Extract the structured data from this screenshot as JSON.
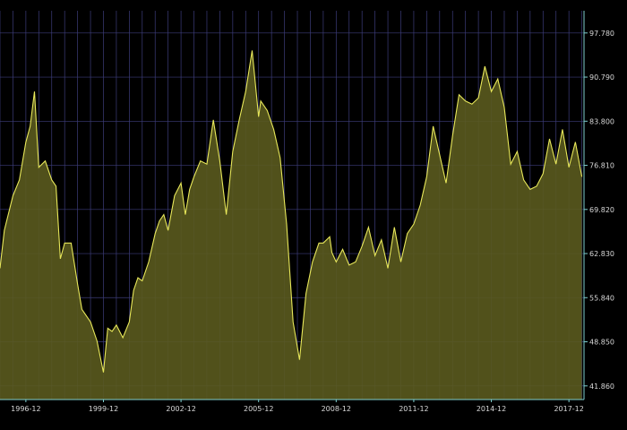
{
  "chart_data": {
    "type": "area",
    "title": "",
    "xlabel": "",
    "ylabel": "",
    "x_tick_labels": [
      "1996-12",
      "1999-12",
      "2002-12",
      "2005-12",
      "2008-12",
      "2011-12",
      "2014-12",
      "2017-12"
    ],
    "y_tick_labels": [
      "97.780",
      "90.790",
      "83.800",
      "76.810",
      "69.820",
      "62.830",
      "55.840",
      "48.850",
      "41.860"
    ],
    "x_range": [
      "1995-12",
      "2018-07"
    ],
    "ylim": [
      39.7,
      101.3
    ],
    "grid": true,
    "colors": {
      "background": "#000000",
      "grid": "#3c3c7a",
      "line": "#e8e85a",
      "fill": "#5a5a1e",
      "axis": "#7fd0d0",
      "tick_text": "#d8d8d8"
    },
    "series": [
      {
        "x": [
          "1995-12",
          "1996-02",
          "1996-06",
          "1996-09",
          "1996-12",
          "1997-02",
          "1997-04",
          "1997-06",
          "1997-09",
          "1997-12",
          "1998-02",
          "1998-04",
          "1998-06",
          "1998-09",
          "1998-12",
          "1999-02",
          "1999-04",
          "1999-06",
          "1999-09",
          "1999-12",
          "2000-02",
          "2000-04",
          "2000-06",
          "2000-09",
          "2000-12",
          "2001-02",
          "2001-04",
          "2001-06",
          "2001-09",
          "2001-12",
          "2002-02",
          "2002-04",
          "2002-06",
          "2002-09",
          "2002-12",
          "2003-02",
          "2003-04",
          "2003-06",
          "2003-09",
          "2003-12",
          "2004-03",
          "2004-06",
          "2004-09",
          "2004-12",
          "2005-03",
          "2005-06",
          "2005-09",
          "2005-12",
          "2006-01",
          "2006-04",
          "2006-07",
          "2006-10",
          "2007-01",
          "2007-04",
          "2007-07",
          "2007-10",
          "2008-01",
          "2008-04",
          "2008-06",
          "2008-09",
          "2008-10",
          "2008-12",
          "2009-03",
          "2009-06",
          "2009-09",
          "2009-12",
          "2010-03",
          "2010-06",
          "2010-09",
          "2010-12",
          "2011-03",
          "2011-06",
          "2011-09",
          "2011-12",
          "2012-03",
          "2012-06",
          "2012-09",
          "2012-12",
          "2013-03",
          "2013-06",
          "2013-09",
          "2013-12",
          "2014-03",
          "2014-06",
          "2014-09",
          "2014-12",
          "2015-03",
          "2015-06",
          "2015-09",
          "2015-12",
          "2016-03",
          "2016-06",
          "2016-09",
          "2016-12",
          "2017-03",
          "2017-06",
          "2017-09",
          "2017-12",
          "2018-03",
          "2018-06"
        ],
        "values": [
          60.5,
          66.5,
          72.0,
          74.5,
          80.5,
          83.0,
          88.5,
          76.5,
          77.5,
          74.5,
          73.5,
          62.0,
          64.5,
          64.5,
          58.0,
          54.0,
          53.0,
          52.0,
          49.0,
          44.0,
          51.0,
          50.5,
          51.5,
          49.5,
          52.0,
          57.0,
          59.0,
          58.5,
          61.5,
          66.0,
          68.0,
          69.0,
          66.5,
          72.0,
          74.0,
          69.0,
          73.0,
          75.0,
          77.5,
          77.0,
          84.0,
          77.5,
          69.0,
          79.0,
          84.0,
          88.5,
          95.0,
          84.5,
          87.0,
          85.5,
          82.5,
          78.0,
          67.5,
          52.0,
          46.0,
          56.5,
          61.5,
          64.5,
          64.5,
          65.5,
          63.0,
          61.5,
          63.5,
          61.0,
          61.5,
          64.0,
          67.0,
          62.5,
          65.0,
          60.5,
          67.0,
          61.5,
          66.0,
          67.5,
          70.5,
          75.0,
          83.0,
          78.5,
          74.0,
          81.5,
          88.0,
          87.0,
          86.5,
          87.5,
          92.5,
          88.5,
          90.5,
          86.0,
          77.0,
          79.0,
          74.5,
          73.0,
          73.5,
          75.5,
          81.0,
          77.0,
          82.5,
          76.5,
          80.5,
          75.0
        ]
      }
    ]
  }
}
